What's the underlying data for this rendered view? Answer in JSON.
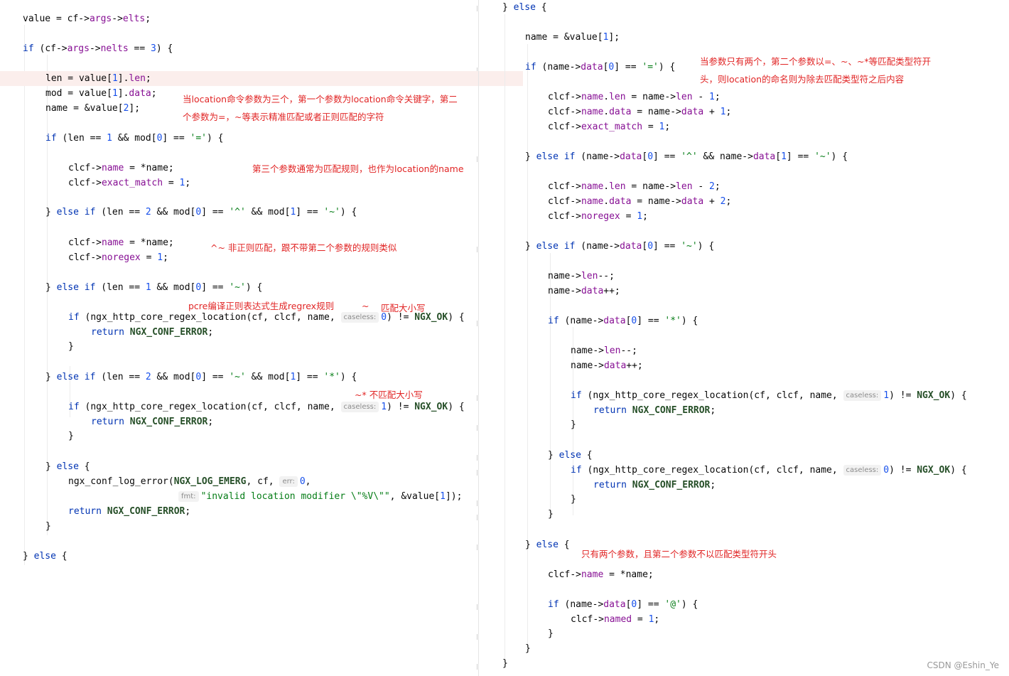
{
  "left": {
    "lines": [
      "value = cf->args->elts;",
      "if (cf->args->nelts == 3) {",
      "len = value[1].len;",
      "mod = value[1].data;",
      "name = &value[2];",
      "if (len == 1 && mod[0] == '=') {",
      "clcf->name = *name;",
      "clcf->exact_match = 1;",
      "} else if (len == 2 && mod[0] == '^' && mod[1] == '~') {",
      "clcf->name = *name;",
      "clcf->noregex = 1;",
      "} else if (len == 1 && mod[0] == '~') {",
      "if (ngx_http_core_regex_location(cf, clcf, name,",
      "caseless:",
      "0) != NGX_OK) {",
      "return NGX_CONF_ERROR;",
      "}",
      "} else if (len == 2 && mod[0] == '~' && mod[1] == '*') {",
      "if (ngx_http_core_regex_location(cf, clcf, name,",
      "caseless:",
      "1) != NGX_OK) {",
      "return NGX_CONF_ERROR;",
      "}",
      "} else {",
      "ngx_conf_log_error(NGX_LOG_EMERG, cf,",
      "err:",
      "0,",
      "fmt:",
      "\"invalid location modifier \\\"%V\\\"\", &value[1]);",
      "return NGX_CONF_ERROR;",
      "}",
      "} else {"
    ],
    "annotations": [
      "当location命令参数为三个，第一个参数为location命令关键字，第二",
      "个参数为=，~等表示精准匹配或者正则匹配的字符",
      "第三个参数通常为匹配规则，也作为location的name",
      "^~ 非正则匹配，跟不带第二个参数的规则类似",
      "pcre编译正则表达式生成regrex规则",
      "~",
      "匹配大小写",
      "~* 不匹配大小写"
    ]
  },
  "right": {
    "lines": [
      "} else {",
      "name = &value[1];",
      "if (name->data[0] == '=') {",
      "clcf->name.len = name->len - 1;",
      "clcf->name.data = name->data + 1;",
      "clcf->exact_match = 1;",
      "} else if (name->data[0] == '^' && name->data[1] == '~') {",
      "clcf->name.len = name->len - 2;",
      "clcf->name.data = name->data + 2;",
      "clcf->noregex = 1;",
      "} else if (name->data[0] == '~') {",
      "name->len--;",
      "name->data++;",
      "if (name->data[0] == '*') {",
      "name->len--;",
      "name->data++;",
      "if (ngx_http_core_regex_location(cf, clcf, name,",
      "caseless:",
      "1) != NGX_OK) {",
      "return NGX_CONF_ERROR;",
      "}",
      "} else {",
      "if (ngx_http_core_regex_location(cf, clcf, name,",
      "caseless:",
      "0) != NGX_OK) {",
      "return NGX_CONF_ERROR;",
      "}",
      "}",
      "} else {",
      "clcf->name = *name;",
      "if (name->data[0] == '@') {",
      "clcf->named = 1;",
      "}",
      "}",
      "}"
    ],
    "annotations": [
      "当参数只有两个，第二个参数以=、~、~*等匹配类型符开",
      "头，则location的命名则为除去匹配类型符之后内容",
      "只有两个参数，且第二个参数不以匹配类型符开头"
    ]
  },
  "watermark": "CSDN @Eshin_Ye",
  "colors": {
    "keyword": "#0033b3",
    "field": "#871094",
    "number": "#1750eb",
    "string": "#067d17",
    "constant": "#264f28",
    "annotation": "#e12525",
    "highlight_line": "#fbeeec"
  }
}
